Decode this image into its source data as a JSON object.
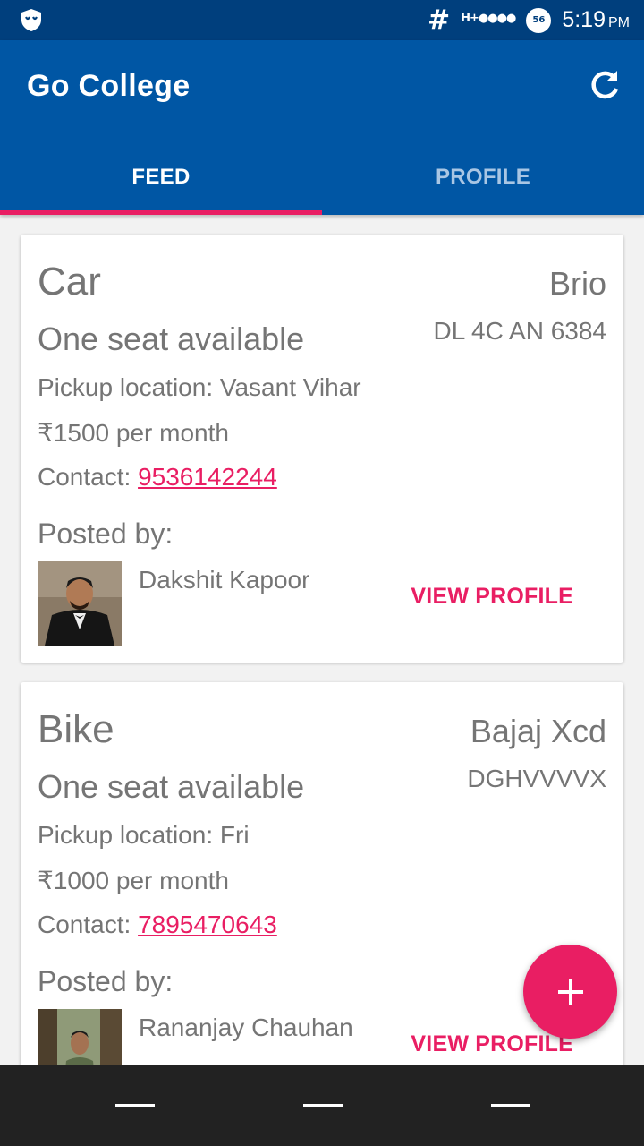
{
  "status_bar": {
    "network_label": "#",
    "signal_label": "H+●●●●",
    "battery_level": "56",
    "time": "5:19",
    "ampm": "PM"
  },
  "app": {
    "title": "Go College"
  },
  "tabs": [
    {
      "label": "FEED",
      "active": true
    },
    {
      "label": "PROFILE",
      "active": false
    }
  ],
  "colors": {
    "primary": "#0056a4",
    "status_bar": "#003f7d",
    "accent": "#e91e63",
    "text_secondary": "#757575"
  },
  "feed": [
    {
      "type": "Car",
      "model": "Brio",
      "plate": "DL 4C AN 6384",
      "seats": "One seat available",
      "pickup": "Pickup location: Vasant Vihar",
      "price": "₹1500 per month",
      "contact_label": "Contact: ",
      "phone": "9536142244",
      "posted_by_label": "Posted by:",
      "poster_name": "Dakshit Kapoor",
      "view_profile_label": "VIEW PROFILE"
    },
    {
      "type": "Bike",
      "model": "Bajaj Xcd",
      "plate": "DGHVVVVX",
      "seats": "One seat available",
      "pickup": "Pickup location: Fri",
      "price": "₹1000 per month",
      "contact_label": "Contact: ",
      "phone": "7895470643",
      "posted_by_label": "Posted by:",
      "poster_name": "Rananjay Chauhan",
      "view_profile_label": "VIEW PROFILE"
    }
  ],
  "fab": {
    "icon": "plus-icon"
  },
  "nav_bar": {
    "buttons": [
      "back-button",
      "home-button",
      "recents-button"
    ]
  }
}
